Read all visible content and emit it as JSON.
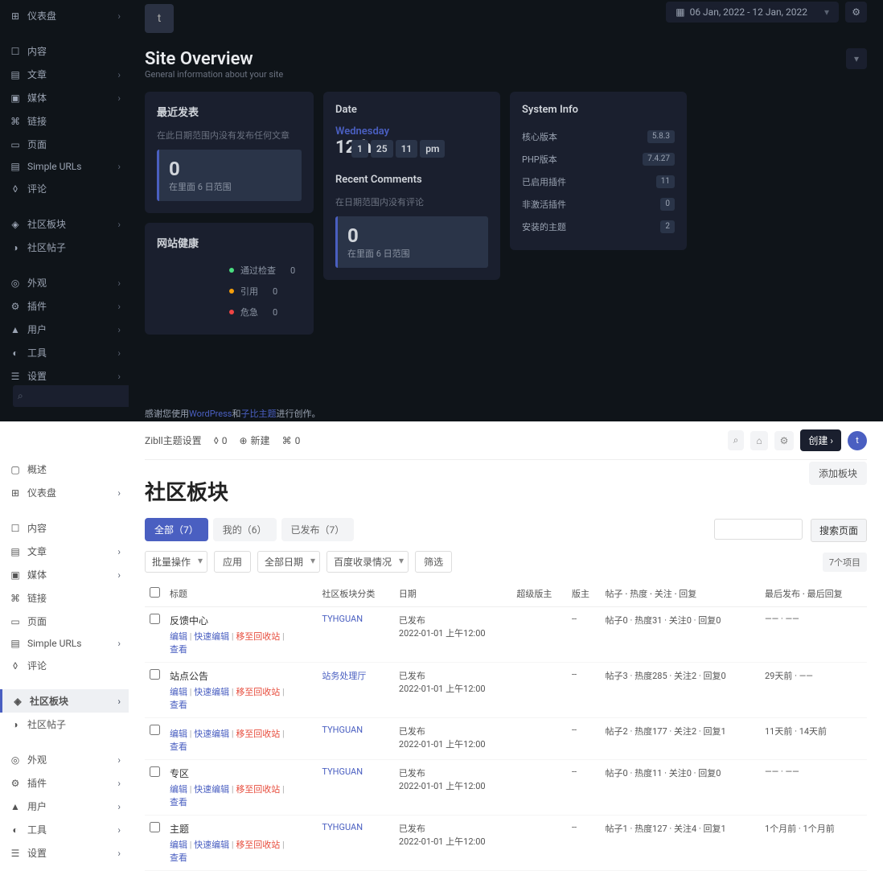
{
  "screen1": {
    "sidebar": {
      "items": [
        {
          "icon": "⊞",
          "label": "仪表盘",
          "chev": true
        },
        {
          "sep": true
        },
        {
          "icon": "☐",
          "label": "内容",
          "chev": false
        },
        {
          "icon": "▤",
          "label": "文章",
          "chev": true
        },
        {
          "icon": "▣",
          "label": "媒体",
          "chev": true
        },
        {
          "icon": "⌘",
          "label": "链接",
          "chev": false
        },
        {
          "icon": "▭",
          "label": "页面",
          "chev": false
        },
        {
          "icon": "▤",
          "label": "Simple URLs",
          "chev": true
        },
        {
          "icon": "◊",
          "label": "评论",
          "chev": false
        },
        {
          "sep": true
        },
        {
          "icon": "◈",
          "label": "社区板块",
          "chev": true
        },
        {
          "icon": "◑",
          "label": "社区帖子",
          "chev": false
        },
        {
          "sep": true
        },
        {
          "icon": "◎",
          "label": "外观",
          "chev": true
        },
        {
          "icon": "⚙",
          "label": "插件",
          "chev": true
        },
        {
          "icon": "▲",
          "label": "用户",
          "chev": true
        },
        {
          "icon": "◐",
          "label": "工具",
          "chev": true
        },
        {
          "icon": "☰",
          "label": "设置",
          "chev": true
        }
      ]
    },
    "avatar": "t",
    "date_range": "06 Jan, 2022 - 12 Jan, 2022",
    "title": "Site Overview",
    "subtitle": "General information about your site",
    "recent_posts": {
      "title": "最近发表",
      "msg": "在此日期范围内没有发布任何文章",
      "num": "0",
      "sub": "在里面 6 日范围"
    },
    "health": {
      "title": "网站健康",
      "rows": [
        {
          "color": "g",
          "label": "通过检查",
          "val": "0"
        },
        {
          "color": "o",
          "label": "引用",
          "val": "0"
        },
        {
          "color": "r",
          "label": "危急",
          "val": "0"
        }
      ]
    },
    "date_card": {
      "title": "Date",
      "day": "Wednesday",
      "num": "12th",
      "time": [
        "1",
        "25",
        "11",
        "pm"
      ]
    },
    "comments": {
      "title": "Recent Comments",
      "msg": "在日期范围内没有评论",
      "num": "0",
      "sub": "在里面 6 日范围"
    },
    "sysinfo": {
      "title": "System Info",
      "rows": [
        {
          "label": "核心版本",
          "val": "5.8.3"
        },
        {
          "label": "PHP版本",
          "val": "7.4.27"
        },
        {
          "label": "已启用插件",
          "val": "11"
        },
        {
          "label": "非激活插件",
          "val": "0"
        },
        {
          "label": "安装的主题",
          "val": "2"
        }
      ]
    },
    "footer": {
      "pre": "感谢您使用",
      "link1": "WordPress",
      "mid": "和",
      "link2": "子比主题",
      "post": "进行创作。"
    }
  },
  "screen2": {
    "topbar": {
      "t1": "Zibll主题设置",
      "t2": "0",
      "t3": "新建",
      "t4": "0",
      "create": "创建"
    },
    "sidebar": {
      "items": [
        {
          "icon": "▢",
          "label": "概述",
          "chev": false
        },
        {
          "icon": "⊞",
          "label": "仪表盘",
          "chev": true
        },
        {
          "sep": true
        },
        {
          "icon": "☐",
          "label": "内容",
          "chev": false
        },
        {
          "icon": "▤",
          "label": "文章",
          "chev": true
        },
        {
          "icon": "▣",
          "label": "媒体",
          "chev": true
        },
        {
          "icon": "⌘",
          "label": "链接",
          "chev": false
        },
        {
          "icon": "▭",
          "label": "页面",
          "chev": false
        },
        {
          "icon": "▤",
          "label": "Simple URLs",
          "chev": true
        },
        {
          "icon": "◊",
          "label": "评论",
          "chev": false
        },
        {
          "sep": true
        },
        {
          "icon": "◈",
          "label": "社区板块",
          "chev": true,
          "active": true
        },
        {
          "icon": "◑",
          "label": "社区帖子",
          "chev": false
        },
        {
          "sep": true
        },
        {
          "icon": "◎",
          "label": "外观",
          "chev": true
        },
        {
          "icon": "⚙",
          "label": "插件",
          "chev": true
        },
        {
          "icon": "▲",
          "label": "用户",
          "chev": true
        },
        {
          "icon": "◐",
          "label": "工具",
          "chev": true
        },
        {
          "icon": "☰",
          "label": "设置",
          "chev": true
        }
      ]
    },
    "page_title": "社区板块",
    "add_btn": "添加板块",
    "tabs": [
      {
        "label": "全部（7）",
        "active": true
      },
      {
        "label": "我的（6）",
        "active": false
      },
      {
        "label": "已发布（7）",
        "active": false
      }
    ],
    "search_btn": "搜索页面",
    "filters": {
      "bulk": "批量操作",
      "apply": "应用",
      "date": "全部日期",
      "baidu": "百度收录情况",
      "filter": "筛选",
      "count": "7个项目"
    },
    "columns": [
      "标题",
      "社区板块分类",
      "日期",
      "超级版主",
      "版主",
      "帖子 · 热度 · 关注 · 回复",
      "最后发布 · 最后回复"
    ],
    "actions": {
      "edit": "编辑",
      "quick": "快速编辑",
      "trash": "移至回收站",
      "view": "查看",
      "sep": " | "
    },
    "rows": [
      {
        "title": "反馈中心",
        "cat": "TYHGUAN",
        "status": "已发布",
        "date": "2022-01-01 上午12:00",
        "super": "",
        "mod": "--",
        "stats": "帖子0 · 热度31 · 关注0 · 回复0",
        "last": "—— · ——"
      },
      {
        "title": "站点公告",
        "cat": "站务处理厅",
        "status": "已发布",
        "date": "2022-01-01 上午12:00",
        "super": "",
        "mod": "--",
        "stats": "帖子3 · 热度285 · 关注2 · 回复0",
        "last": "29天前 · ——"
      },
      {
        "title": "",
        "cat": "TYHGUAN",
        "status": "已发布",
        "date": "2022-01-01 上午12:00",
        "super": "",
        "mod": "--",
        "stats": "帖子2 · 热度177 · 关注2 · 回复1",
        "last": "11天前 · 14天前"
      },
      {
        "title": "专区",
        "cat": "TYHGUAN",
        "status": "已发布",
        "date": "2022-01-01 上午12:00",
        "super": "",
        "mod": "--",
        "stats": "帖子0 · 热度11 · 关注0 · 回复0",
        "last": "—— · ——"
      },
      {
        "title": "主题",
        "cat": "TYHGUAN",
        "status": "已发布",
        "date": "2022-01-01 上午12:00",
        "super": "",
        "mod": "--",
        "stats": "帖子1 · 热度127 · 关注4 · 回复1",
        "last": "1个月前 · 1个月前"
      }
    ]
  }
}
